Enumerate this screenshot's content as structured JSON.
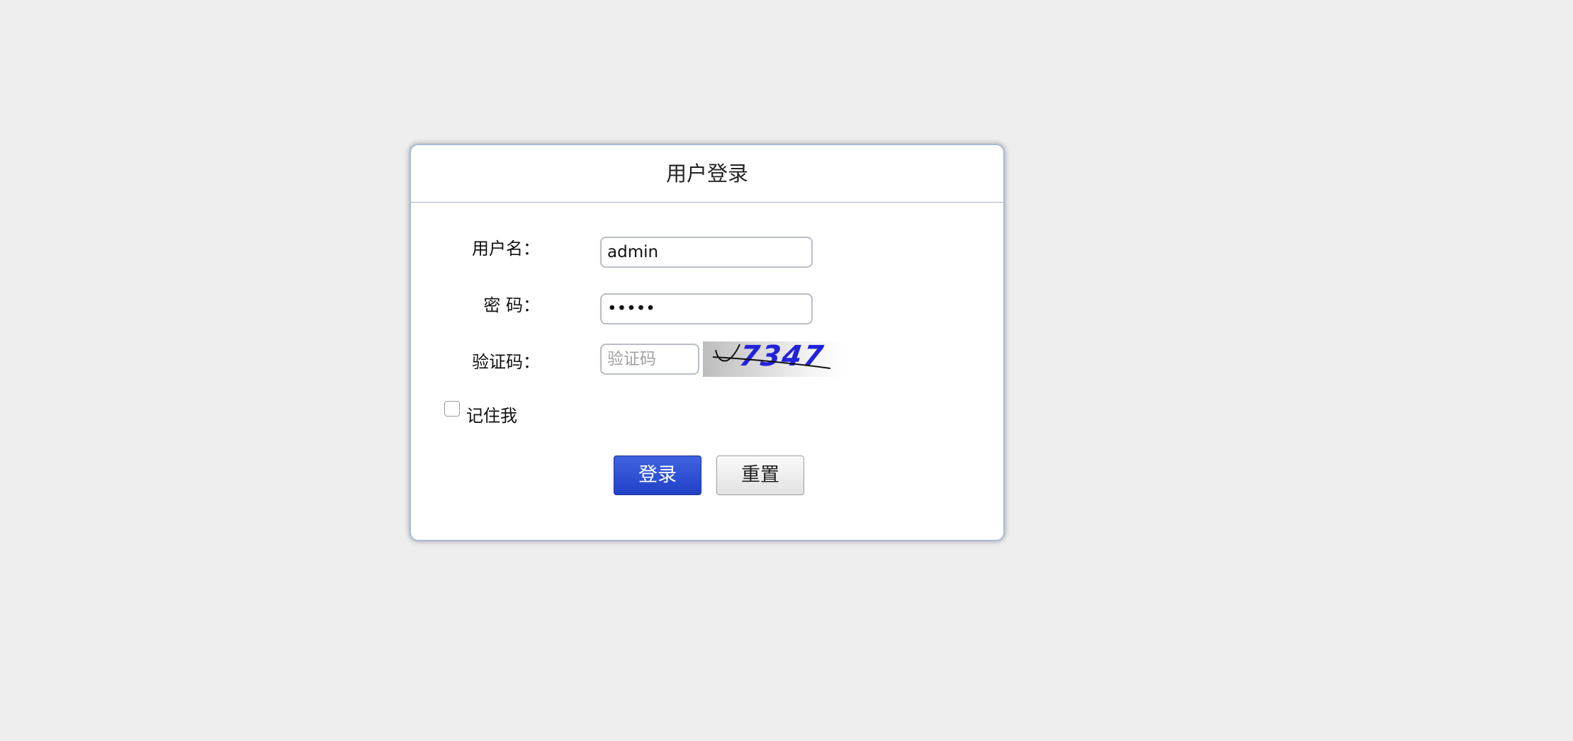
{
  "form": {
    "title": "用户登录",
    "username_label": "用户名：",
    "username_value": "admin",
    "password_label": "密 码：",
    "password_value": "•••••",
    "captcha_label": "验证码：",
    "captcha_placeholder": "验证码",
    "captcha_image_text": "7347",
    "remember_label": "记住我",
    "login_button": "登录",
    "reset_button": "重置"
  },
  "colors": {
    "background": "#eeeeee",
    "login_button": "#2c4fd6",
    "captcha_text": "#2222dd"
  }
}
